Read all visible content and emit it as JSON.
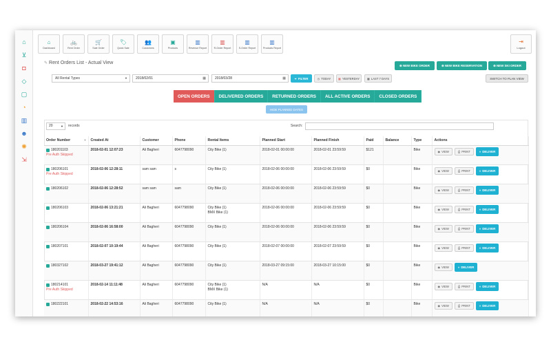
{
  "toolbar": {
    "buttons": [
      {
        "label": "Dashboard",
        "icon": "home-icon",
        "glyph": "⌂"
      },
      {
        "label": "Rent Order",
        "icon": "bike-icon",
        "glyph": "🚲"
      },
      {
        "label": "Sale Order",
        "icon": "cart-icon",
        "glyph": "🛒"
      },
      {
        "label": "Quick Sale",
        "icon": "tag-icon",
        "glyph": "🏷"
      },
      {
        "label": "Customers",
        "icon": "users-icon",
        "glyph": "👥"
      },
      {
        "label": "Products",
        "icon": "cube-icon",
        "glyph": "▣"
      },
      {
        "label": "Revenue Report",
        "icon": "bar-chart-icon",
        "glyph": "▥"
      },
      {
        "label": "R-Order Report",
        "icon": "bar-chart-icon",
        "glyph": "▥"
      },
      {
        "label": "S-Order Report",
        "icon": "bar-chart-icon",
        "glyph": "▥"
      },
      {
        "label": "Products Report",
        "icon": "bar-chart-icon",
        "glyph": "▥"
      }
    ],
    "logout_label": "Logout"
  },
  "sidebar": {
    "icons": [
      "home-icon",
      "cart-icon",
      "camera-icon",
      "layers-icon",
      "box-icon",
      "bell-icon",
      "chart-icon",
      "users-icon",
      "settings-icon",
      "logout-icon"
    ]
  },
  "page": {
    "title": "Rent Orders List - Actual View",
    "new_bike_order": "NEW BIKE ORDER",
    "new_bike_reservation": "NEW BIKE RESERVATION",
    "new_ski_order": "NEW SKI ORDER",
    "switch_plan": "SWITCH TO PLAN VIEW"
  },
  "filters": {
    "rental_type": "All Rental Types",
    "date_from": "2018/02/01",
    "date_to": "2018/03/28",
    "filter_label": "FILTER",
    "today_label": "TODAY",
    "yesterday_label": "YESTERDAY",
    "last7_label": "LAST 7 DAYS"
  },
  "tabs": [
    "OPEN ORDERS",
    "DELIVERED ORDERS",
    "RETURNED ORDERS",
    "ALL ACTIVE ORDERS",
    "CLOSED ORDERS"
  ],
  "hide_planned_label": "HIDE PLANNED DATES",
  "table_controls": {
    "page_length": "20",
    "records_label": "records",
    "search_label": "Search:"
  },
  "columns": [
    "Order Number",
    "Created At",
    "Customer",
    "Phone",
    "Rental Items",
    "Planned Start",
    "Planned Finish",
    "Paid",
    "Balance",
    "Type",
    "Actions"
  ],
  "actions": {
    "view": "VIEW",
    "print": "PRINT",
    "deliver": "DELIVER"
  },
  "rows": [
    {
      "order": "180201103",
      "note": "Pre Auth Skipped",
      "created": "2018-02-01 12:07:23",
      "customer": "Ali Bagheri",
      "phone": "6047798090",
      "items": [
        "City Bike (1)"
      ],
      "start": "2018-02-01 00:00:00",
      "finish": "2018-02-01 23:59:59",
      "paid": "$121",
      "balance": "",
      "type": "Bike",
      "has_print": true
    },
    {
      "order": "180206101",
      "note": "Pre Auth Skipped",
      "created": "2018-02-06 12:28:11",
      "customer": "sam sam",
      "phone": "s",
      "items": [
        "City Bike (1)"
      ],
      "start": "2018-02-06 00:00:00",
      "finish": "2018-02-06 23:59:59",
      "paid": "$0",
      "balance": "",
      "type": "Bike",
      "has_print": true
    },
    {
      "order": "180206102",
      "note": "",
      "created": "2018-02-06 12:28:52",
      "customer": "sam sam",
      "phone": "sam",
      "items": [
        "City Bike (1)"
      ],
      "start": "2018-02-06 00:00:00",
      "finish": "2018-02-06 23:59:59",
      "paid": "$0",
      "balance": "",
      "type": "Bike",
      "has_print": true
    },
    {
      "order": "180206103",
      "note": "",
      "created": "2018-02-06 13:21:21",
      "customer": "Ali Bagheri",
      "phone": "6047798090",
      "items": [
        "City Bike (1)",
        "BMX Bike (1)"
      ],
      "start": "2018-02-06 00:00:00",
      "finish": "2018-02-06 23:59:59",
      "paid": "$0",
      "balance": "",
      "type": "Bike",
      "has_print": true
    },
    {
      "order": "180206104",
      "note": "",
      "created": "2018-02-06 16:58:00",
      "customer": "Ali Bagheri",
      "phone": "6047798090",
      "items": [
        "City Bike (1)"
      ],
      "start": "2018-02-06 00:00:00",
      "finish": "2018-02-06 23:59:59",
      "paid": "$0",
      "balance": "",
      "type": "Bike",
      "has_print": true
    },
    {
      "order": "180207101",
      "note": "",
      "created": "2018-02-07 10:19:44",
      "customer": "Ali Bagheri",
      "phone": "6047798090",
      "items": [
        "City Bike (1)"
      ],
      "start": "2018-02-07 00:00:00",
      "finish": "2018-02-07 23:59:59",
      "paid": "$0",
      "balance": "",
      "type": "Bike",
      "has_print": true
    },
    {
      "order": "180327102",
      "note": "",
      "created": "2018-03-27 19:41:12",
      "customer": "Ali Bagheri",
      "phone": "6047798090",
      "items": [
        "City Bike (1)"
      ],
      "start": "2018-03-27 09:15:00",
      "finish": "2018-03-27 10:15:00",
      "paid": "$0",
      "balance": "",
      "type": "Bike",
      "has_print": false
    },
    {
      "order": "180214101",
      "note": "Pre Auth Skipped",
      "created": "2018-02-14 11:11:48",
      "customer": "Ali Bagheri",
      "phone": "6047798090",
      "items": [
        "City Bike (1)",
        "BMX Bike (1)"
      ],
      "start": "N/A",
      "finish": "N/A",
      "paid": "$0",
      "balance": "",
      "type": "Bike",
      "has_print": true
    },
    {
      "order": "180222101",
      "note": "",
      "created": "2018-02-22 14:53:16",
      "customer": "Ali Bagheri",
      "phone": "6047798090",
      "items": [
        "City Bike (1)"
      ],
      "start": "N/A",
      "finish": "N/A",
      "paid": "$0",
      "balance": "",
      "type": "Bike",
      "has_print": true
    }
  ],
  "colors": {
    "accent": "#27a99a",
    "active_tab": "#e05a5a",
    "deliver": "#1fb1d2",
    "filter": "#2bb7d6"
  }
}
